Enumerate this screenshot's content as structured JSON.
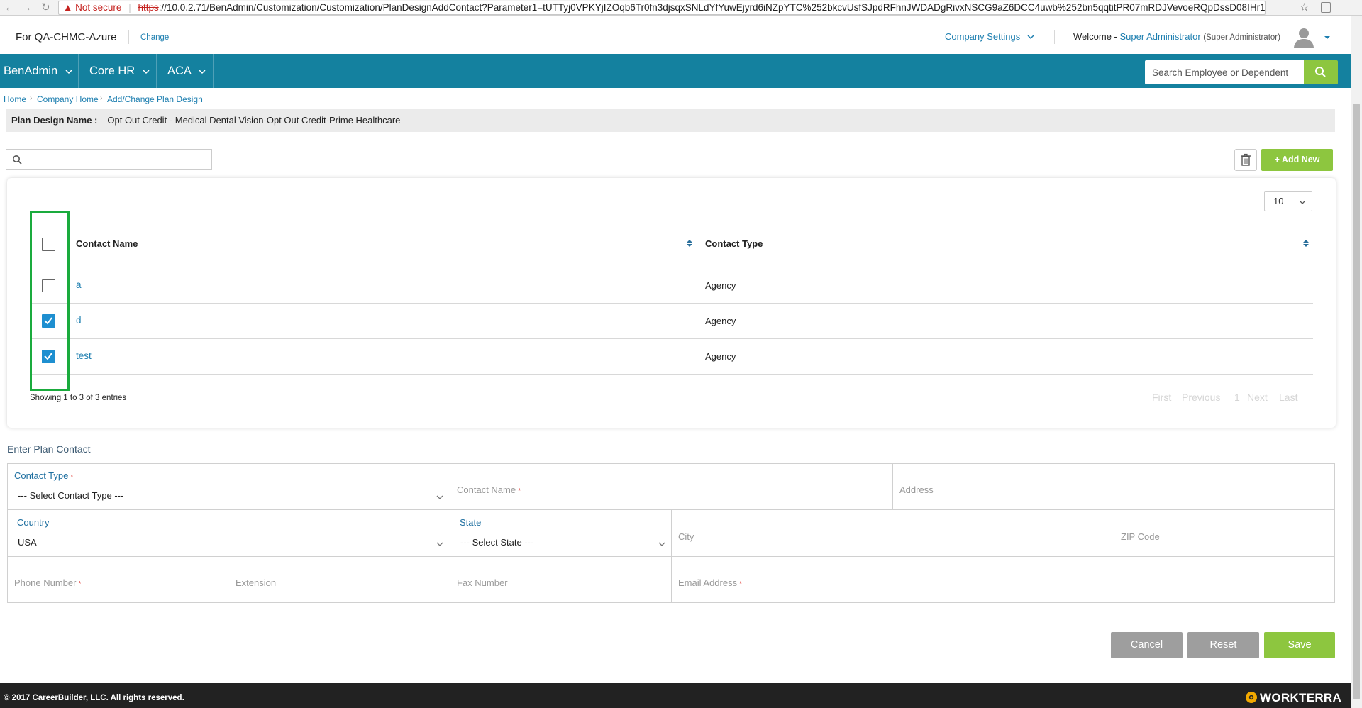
{
  "browser": {
    "security_label": "Not secure",
    "url_protocol": "https",
    "url_rest": "://10.0.2.71/BenAdmin/Customization/Customization/PlanDesignAddContact?Parameter1=tUTTyj0VPKYjIZOqb6Tr0fn3djsqxSNLdYfYuwEjyrd6iNZpYTC%252bkcvUsfSJpdRFhnJWDADgRivxNSCG9aZ6DCC4uwb%252bn5qqtitPR07mRDJVevoeRQpDssD08IHr1N..."
  },
  "header": {
    "client": "For QA-CHMC-Azure",
    "change_label": "Change",
    "company_settings": "Company Settings",
    "welcome_prefix": "Welcome - ",
    "user_name": "Super Administrator",
    "user_role": "(Super Administrator)"
  },
  "nav": {
    "items": [
      {
        "label": "BenAdmin"
      },
      {
        "label": "Core HR"
      },
      {
        "label": "ACA"
      }
    ],
    "search_placeholder": "Search Employee or Dependent"
  },
  "breadcrumb": [
    "Home",
    "Company Home",
    "Add/Change Plan Design"
  ],
  "plan": {
    "label": "Plan Design Name :",
    "value": "Opt Out Credit - Medical Dental Vision-Opt Out Credit-Prime Healthcare"
  },
  "toolbar": {
    "search_value": "",
    "add_new_label": "Add New"
  },
  "table": {
    "page_size": "10",
    "columns": [
      "Contact Name",
      "Contact Type"
    ],
    "rows": [
      {
        "name": "a",
        "type": "Agency",
        "checked": false
      },
      {
        "name": "d",
        "type": "Agency",
        "checked": true
      },
      {
        "name": "test",
        "type": "Agency",
        "checked": true
      }
    ],
    "showing": "Showing 1 to 3 of 3 entries",
    "pager": [
      "First",
      "Previous",
      "1",
      "Next",
      "Last"
    ]
  },
  "form": {
    "title": "Enter Plan Contact",
    "contact_type_label": "Contact Type",
    "contact_type_value": "--- Select Contact Type ---",
    "contact_name_placeholder": "Contact Name",
    "address_placeholder": "Address",
    "country_label": "Country",
    "country_value": "USA",
    "state_label": "State",
    "state_value": "--- Select State ---",
    "city_placeholder": "City",
    "zip_placeholder": "ZIP Code",
    "phone_placeholder": "Phone Number",
    "extension_placeholder": "Extension",
    "fax_placeholder": "Fax Number",
    "email_placeholder": "Email Address",
    "required_mark": "*"
  },
  "actions": {
    "cancel": "Cancel",
    "reset": "Reset",
    "save": "Save"
  },
  "footer": {
    "copyright": "© 2017 CareerBuilder, LLC. All rights reserved.",
    "logo": "WORKTERRA"
  },
  "colors": {
    "nav_bg": "#14819f",
    "accent_green": "#8dc63f",
    "link_blue": "#1e7fb0",
    "checkbox_checked": "#1e8fd0",
    "highlight_green": "#1aab3d",
    "button_gray": "#9e9e9e",
    "footer_bg": "#222222"
  }
}
